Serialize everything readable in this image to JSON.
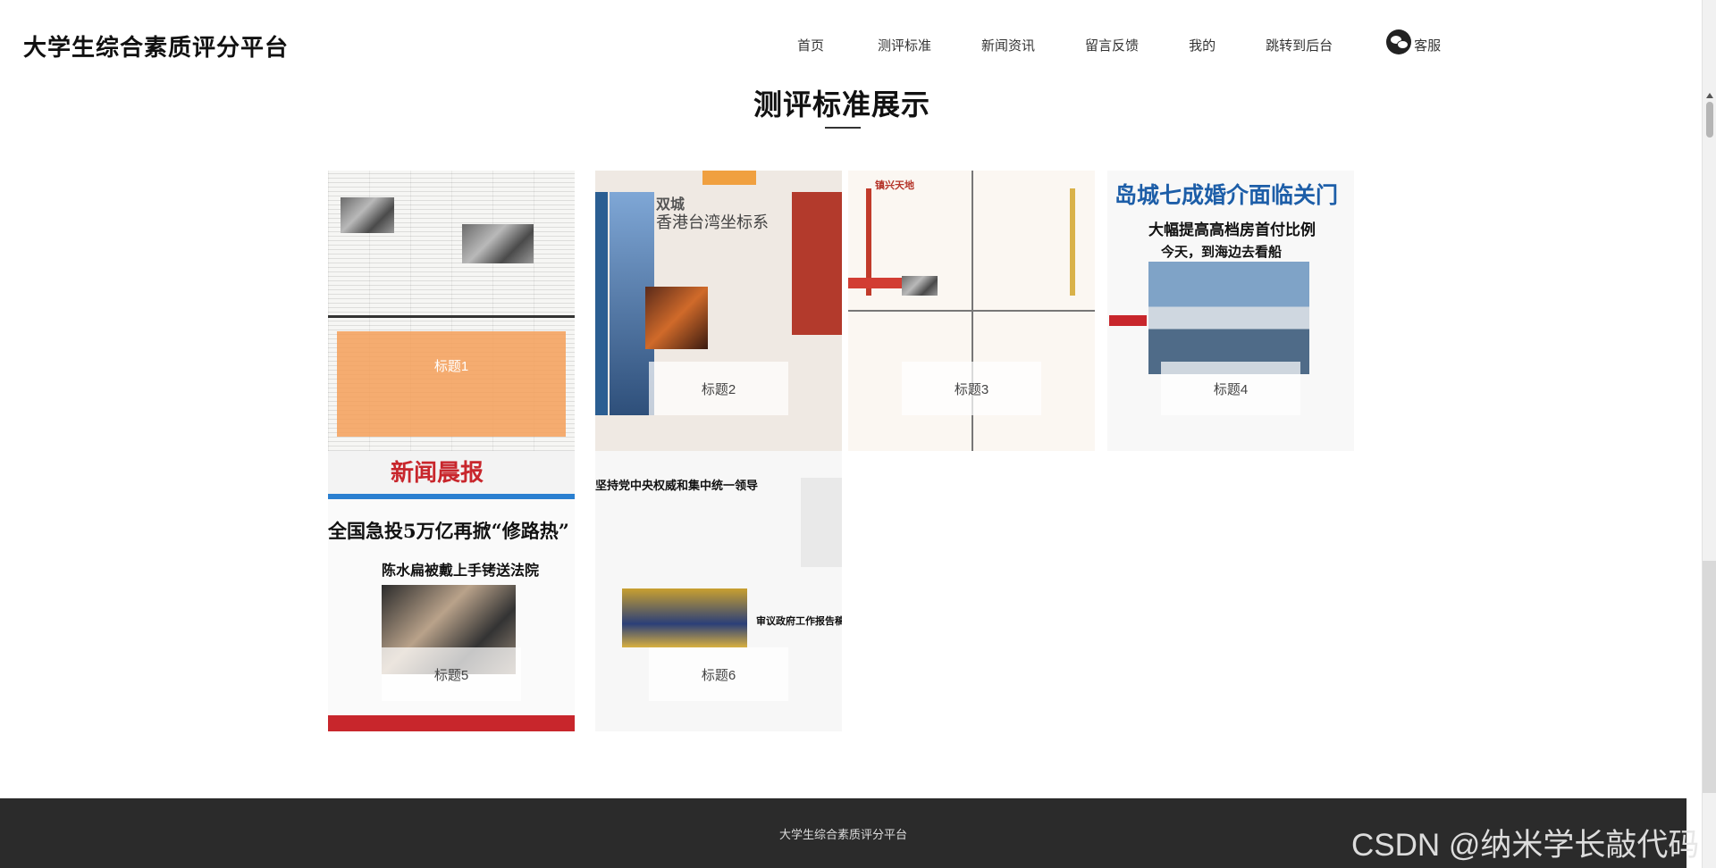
{
  "header": {
    "site_title": "大学生综合素质评分平台",
    "nav": [
      "首页",
      "测评标准",
      "新闻资讯",
      "留言反馈",
      "我的",
      "跳转到后台"
    ],
    "service_label": "客服",
    "service_icon": "wechat-icon"
  },
  "section": {
    "title": "测评标准展示"
  },
  "cards": [
    {
      "label": "标题1",
      "state": "hover"
    },
    {
      "label": "标题2",
      "headline": "香港台湾坐标系",
      "masthead": "双城"
    },
    {
      "label": "标题3",
      "masthead": "镇兴天地"
    },
    {
      "label": "标题4",
      "headline": "岛城七成婚介面临关门",
      "subhead": "大幅提高高档房首付比例",
      "subhead2": "今天，到海边去看船"
    },
    {
      "label": "标题5",
      "masthead": "新闻晨报",
      "headline": "全国急投5万亿再掀“修路热”",
      "subhead": "陈水扁被戴上手铐送法院"
    },
    {
      "label": "标题6",
      "headline": "坚持党中央权威和集中统一领导",
      "subhead": "审议政府工作报告稿"
    }
  ],
  "footer": {
    "text": "大学生综合素质评分平台"
  },
  "watermark": "CSDN @纳米学长敲代码",
  "colors": {
    "hover_overlay": "#f5a05a",
    "footer_bg": "#2b2b2b"
  }
}
